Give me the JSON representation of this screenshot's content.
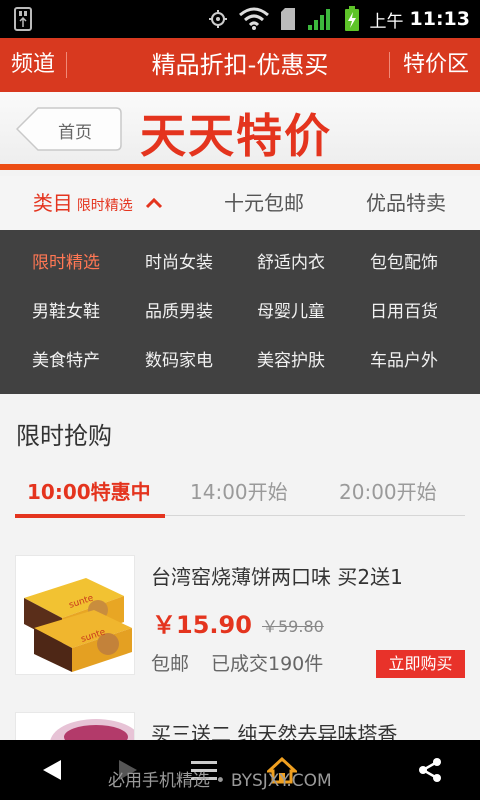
{
  "status_bar": {
    "ampm": "上午",
    "time": "11:13"
  },
  "title_bar": {
    "left_label": "频道",
    "title": "精品折扣-优惠买",
    "right_label": "特价区"
  },
  "banner": {
    "home_label": "首页",
    "brand_title": "天天特价"
  },
  "tabs": {
    "category_label": "类目",
    "category_selected": "限时精选",
    "tab2": "十元包邮",
    "tab3": "优品特卖"
  },
  "category_menu": {
    "items": [
      "限时精选",
      "时尚女装",
      "舒适内衣",
      "包包配饰",
      "男鞋女鞋",
      "品质男装",
      "母婴儿童",
      "日用百货",
      "美食特产",
      "数码家电",
      "美容护肤",
      "车品户外"
    ],
    "active_index": 0
  },
  "flash_sale": {
    "title": "限时抢购",
    "time_tabs": [
      "10:00特惠中",
      "14:00开始",
      "20:00开始"
    ],
    "active_time_tab": 0
  },
  "products": [
    {
      "name": "台湾窑烧薄饼两口味 买2送1",
      "price": "￥15.90",
      "original_price": "￥59.80",
      "shipping": "包邮",
      "sold": "已成交190件",
      "buy_label": "立即购买"
    },
    {
      "name": "买三送二 纯天然去异味塔香"
    }
  ],
  "nav_bar": {
    "watermark": "必用手机精选 • BYSJXY.COM"
  },
  "colors": {
    "brand_red": "#e4341e",
    "menu_bg": "#414141",
    "title_red": "#d8391f"
  }
}
